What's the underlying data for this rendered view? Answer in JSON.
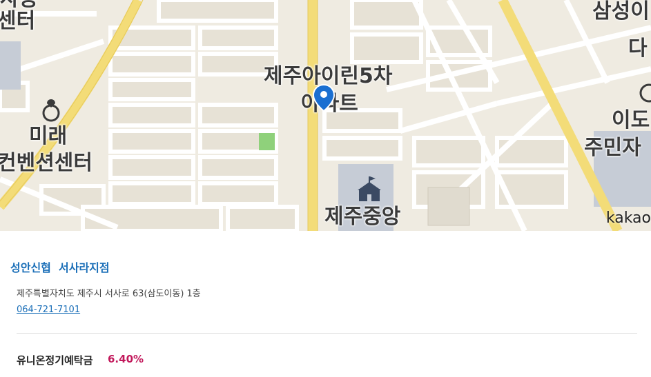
{
  "map": {
    "labels": {
      "top_left": "센터",
      "top_left_partial": "사용",
      "mirae_line1": "미래",
      "mirae_line2": "컨벤션센터",
      "apt_line1": "제주아이린5차",
      "apt_line2": "아파트",
      "jeju_jungang": "제주중앙",
      "samseong": "삼성이",
      "da": "다",
      "ido": "이도",
      "jumin": "주민자"
    },
    "attribution": "kakao",
    "marker_icon": "location-pin-icon",
    "colors": {
      "background": "#f0ece2",
      "road_major": "#f5e07a",
      "road_minor": "#ffffff",
      "park": "#8fd17b",
      "marker": "#1a6fd1"
    }
  },
  "info": {
    "branch_name": "성안신협  서사라지점",
    "address": "제주특별자치도 제주시 서사로 63(삼도이동) 1층",
    "phone": "064-721-7101",
    "product_name": "유니온정기예탁금",
    "rate": "6.40%"
  }
}
